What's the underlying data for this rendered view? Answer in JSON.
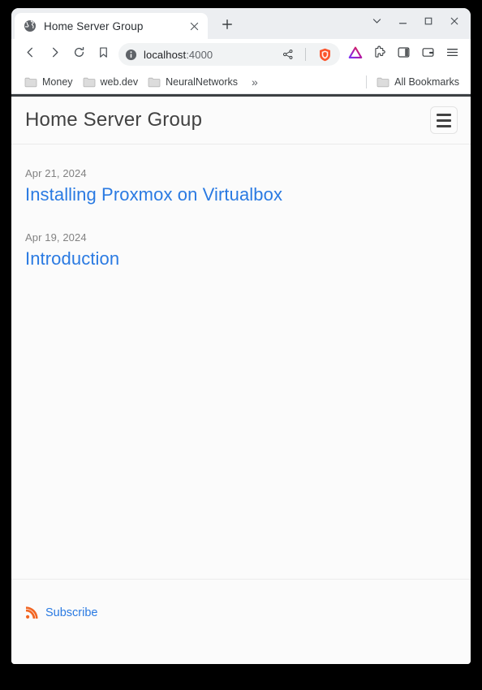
{
  "browser": {
    "tab": {
      "title": "Home Server Group",
      "favicon_icon": "globe-icon",
      "close_icon": "close-icon"
    },
    "new_tab_icon": "plus-icon",
    "window_controls": {
      "tab_search_icon": "chevron-down-icon",
      "minimize_icon": "minimize-icon",
      "maximize_icon": "maximize-icon",
      "close_icon": "close-icon"
    },
    "toolbar": {
      "back_icon": "back-arrow-icon",
      "forward_icon": "forward-arrow-icon",
      "reload_icon": "reload-icon",
      "bookmark_icon": "bookmark-icon",
      "site_info_icon": "info-icon",
      "url_host": "localhost",
      "url_port": ":4000",
      "share_icon": "share-icon",
      "shields_icon": "brave-shields-lion-icon",
      "extension_icon": "triangle-extension-icon",
      "extensions_puzzle_icon": "puzzle-piece-icon",
      "sidebar_icon": "sidebar-panel-icon",
      "wallet_icon": "wallet-icon",
      "menu_icon": "hamburger-menu-icon"
    },
    "bookmarks": {
      "items": [
        {
          "label": "Money",
          "icon": "folder-icon"
        },
        {
          "label": "web.dev",
          "icon": "folder-icon"
        },
        {
          "label": "NeuralNetworks",
          "icon": "folder-icon"
        }
      ],
      "overflow_label": "»",
      "all_bookmarks_label": "All Bookmarks",
      "all_bookmarks_icon": "folder-icon"
    }
  },
  "page": {
    "header": {
      "site_title": "Home Server Group",
      "menu_button_icon": "hamburger-menu-icon"
    },
    "posts": [
      {
        "date": "Apr 21, 2024",
        "title": "Installing Proxmox on Virtualbox"
      },
      {
        "date": "Apr 19, 2024",
        "title": "Introduction"
      }
    ],
    "footer": {
      "subscribe_label": "Subscribe",
      "rss_icon": "rss-feed-icon"
    }
  },
  "colors": {
    "link_blue": "#2a7ae2",
    "rss_orange": "#f26522",
    "brave_orange": "#fb542b",
    "date_gray": "#828282"
  }
}
